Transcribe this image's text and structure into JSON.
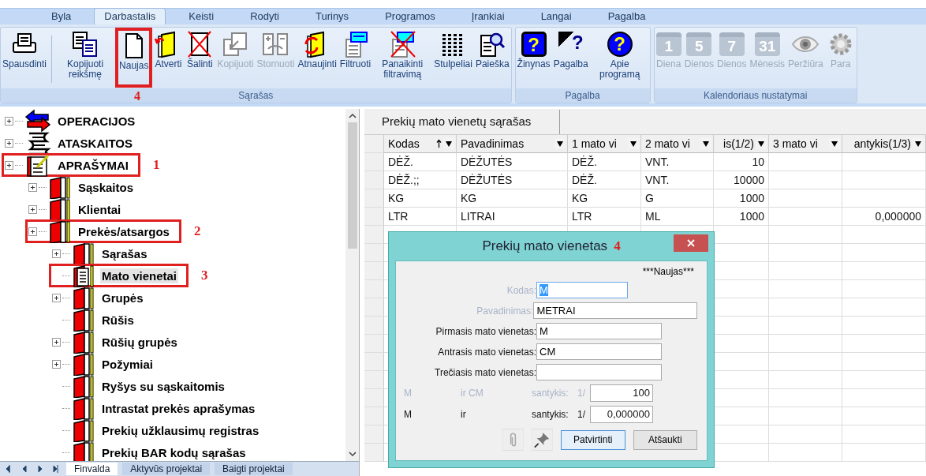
{
  "ribbon_tabs": [
    {
      "label": "Byla",
      "selected": false
    },
    {
      "label": "Darbastalis",
      "selected": true
    },
    {
      "label": "Keisti",
      "selected": false
    },
    {
      "label": "Rodyti",
      "selected": false
    },
    {
      "label": "Turinys",
      "selected": false
    },
    {
      "label": "Programos",
      "selected": false
    },
    {
      "label": "Įrankiai",
      "selected": false
    },
    {
      "label": "Langai",
      "selected": false
    },
    {
      "label": "Pagalba",
      "selected": false
    }
  ],
  "ribbon_groups": [
    {
      "label": "Sąrašas",
      "buttons": [
        {
          "label": "Spausdinti",
          "disabled": false,
          "separator_after": true
        },
        {
          "label": "Kopijuoti reikšmę",
          "disabled": false
        },
        {
          "label": "Naujas",
          "disabled": false,
          "annotation": "4"
        },
        {
          "label": "Atverti",
          "disabled": false
        },
        {
          "label": "Šalinti",
          "disabled": false
        },
        {
          "label": "Kopijuoti",
          "disabled": true
        },
        {
          "label": "Stornuoti",
          "disabled": true
        },
        {
          "label": "Atnaujinti",
          "disabled": false
        },
        {
          "label": "Filtruoti",
          "disabled": false
        },
        {
          "label": "Panaikinti filtravimą",
          "disabled": false
        },
        {
          "label": "Stulpeliai",
          "disabled": false
        },
        {
          "label": "Paieška",
          "disabled": false
        }
      ]
    },
    {
      "label": "Pagalba",
      "buttons": [
        {
          "label": "Žinynas",
          "disabled": false,
          "badge": "?"
        },
        {
          "label": "Pagalba",
          "disabled": false,
          "badge": "?"
        },
        {
          "label": "Apie programą",
          "disabled": false,
          "badge": "?"
        }
      ]
    },
    {
      "label": "Kalendoriaus nustatymai",
      "buttons": [
        {
          "label": "Diena",
          "disabled": true,
          "badge": "1"
        },
        {
          "label": "Dienos",
          "disabled": true,
          "badge": "5"
        },
        {
          "label": "Dienos",
          "disabled": true,
          "badge": "7"
        },
        {
          "label": "Mėnesis",
          "disabled": true,
          "badge": "31"
        },
        {
          "label": "Peržiūra",
          "disabled": true
        },
        {
          "label": "Para",
          "disabled": true
        }
      ]
    }
  ],
  "tree": [
    {
      "label": "OPERACIJOS",
      "kind": "operations",
      "expandable": true,
      "selected": false
    },
    {
      "label": "ATASKAITOS",
      "kind": "reports",
      "expandable": true,
      "selected": false
    },
    {
      "label": "APRAŠYMAI",
      "kind": "descriptions",
      "expandable": true,
      "selected": false,
      "annotation": "1",
      "children": [
        {
          "label": "Sąskaitos",
          "kind": "folder",
          "expandable": true,
          "selected": false
        },
        {
          "label": "Klientai",
          "kind": "folder",
          "expandable": true,
          "selected": false
        },
        {
          "label": "Prekės/atsargos",
          "kind": "folder",
          "expandable": true,
          "selected": false,
          "annotation": "2",
          "children": [
            {
              "label": "Sąrašas",
              "kind": "folder",
              "expandable": true,
              "selected": false
            },
            {
              "label": "Mato vienetai",
              "kind": "list",
              "expandable": false,
              "selected": true,
              "annotation": "3"
            },
            {
              "label": "Grupės",
              "kind": "folder",
              "expandable": true,
              "selected": false
            },
            {
              "label": "Rūšis",
              "kind": "folder",
              "expandable": false,
              "selected": false
            },
            {
              "label": "Rūšių grupės",
              "kind": "folder",
              "expandable": true,
              "selected": false
            },
            {
              "label": "Požymiai",
              "kind": "folder",
              "expandable": true,
              "selected": false
            },
            {
              "label": "Ryšys su sąskaitomis",
              "kind": "folder",
              "expandable": false,
              "selected": false
            },
            {
              "label": "Intrastat prekės aprašymas",
              "kind": "folder",
              "expandable": false,
              "selected": false
            },
            {
              "label": "Prekių užklausimų registras",
              "kind": "folder",
              "expandable": false,
              "selected": false
            },
            {
              "label": "Prekių BAR kodų sąrašas",
              "kind": "folder",
              "expandable": false,
              "selected": false
            }
          ]
        }
      ]
    }
  ],
  "bottom_tabs": [
    {
      "label": "Finvalda",
      "selected": true
    },
    {
      "label": "Aktyvūs projektai",
      "selected": false
    },
    {
      "label": "Baigti projektai",
      "selected": false
    }
  ],
  "list_panel": {
    "title": "Prekių mato vienetų sąrašas",
    "columns": [
      {
        "label": "Kodas",
        "sorted": true
      },
      {
        "label": "Pavadinimas",
        "sorted": false
      },
      {
        "label": "1 mato vi",
        "sorted": false
      },
      {
        "label": "2 mato vi",
        "sorted": false
      },
      {
        "label": "is(1/2)",
        "sorted": false
      },
      {
        "label": "3 mato vi",
        "sorted": false
      },
      {
        "label": "antykis(1/3)",
        "sorted": false
      }
    ],
    "rows": [
      [
        "DĖŽ.",
        "DĖŽUTĖS",
        "DĖŽ.",
        "VNT.",
        "10",
        "",
        ""
      ],
      [
        "DĖŽ.;;",
        "DĖŽUTĖS",
        "DĖŽ.",
        "VNT.",
        "10000",
        "",
        ""
      ],
      [
        "KG",
        "KG",
        "KG",
        "G",
        "1000",
        "",
        ""
      ],
      [
        "LTR",
        "LITRAI",
        "LTR",
        "ML",
        "1000",
        "",
        "0,000000"
      ]
    ]
  },
  "dialog": {
    "title": "Prekių mato vienetas",
    "annotation": "4",
    "status": "***Naujas***",
    "fields": [
      {
        "label": "Kodas:",
        "value": "M",
        "disabled": true,
        "selected_text": true
      },
      {
        "label": "Pavadinimas:",
        "value": "METRAI",
        "disabled": true,
        "selected_text": false
      },
      {
        "label": "Pirmasis mato vienetas:",
        "value": "M",
        "disabled": false,
        "selected_text": false
      },
      {
        "label": "Antrasis mato vienetas:",
        "value": "CM",
        "disabled": false,
        "selected_text": false
      },
      {
        "label": "Trečiasis mato vienetas:",
        "disabled": false,
        "selected_text": false
      }
    ],
    "ratios": [
      {
        "unit_a": "M",
        "unit_b": "ir CM",
        "label": "santykis:",
        "prefix": "1/",
        "value": "100",
        "disabled": true
      },
      {
        "unit_a": "M",
        "unit_b": "ir",
        "label": "santykis:",
        "prefix": "1/",
        "value": "0,000000",
        "disabled": false
      }
    ],
    "buttons": [
      {
        "label": "Patvirtinti",
        "focused": true
      },
      {
        "label": "Atšaukti",
        "focused": false
      }
    ]
  }
}
